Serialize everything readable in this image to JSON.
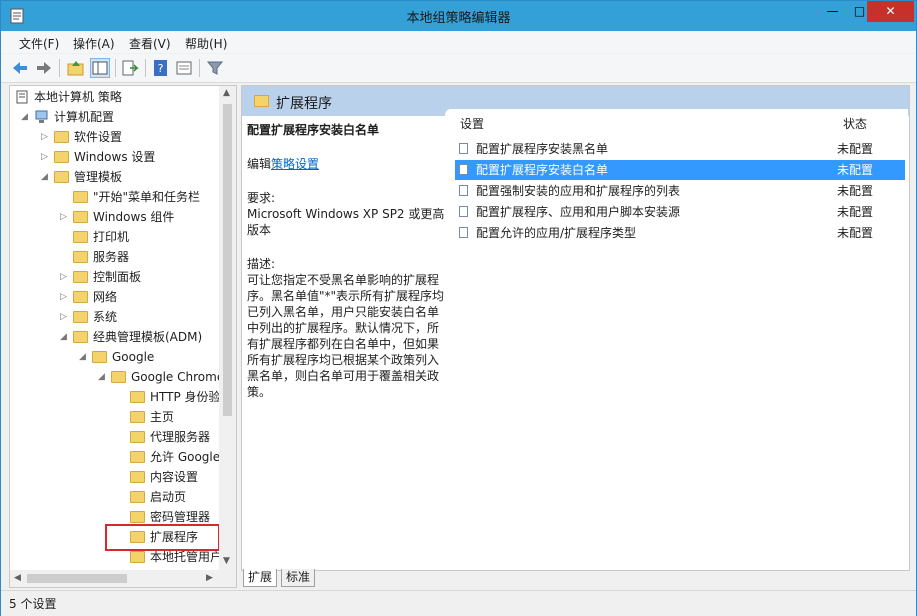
{
  "window": {
    "title": "本地组策略编辑器",
    "minimize": "—",
    "maximize": "□",
    "close": "✕"
  },
  "menu": [
    "文件(F)",
    "操作(A)",
    "查看(V)",
    "帮助(H)"
  ],
  "toolbar_icons": [
    "back-icon",
    "forward-icon",
    "up-folder-icon",
    "show-hide-tree-icon",
    "export-list-icon",
    "help-icon",
    "properties-icon",
    "filter-icon"
  ],
  "tree": {
    "root": "本地计算机 策略",
    "items": [
      {
        "label": "计算机配置"
      },
      {
        "label": "软件设置"
      },
      {
        "label": "Windows 设置"
      },
      {
        "label": "管理模板"
      },
      {
        "label": "\"开始\"菜单和任务栏"
      },
      {
        "label": "Windows 组件"
      },
      {
        "label": "打印机"
      },
      {
        "label": "服务器"
      },
      {
        "label": "控制面板"
      },
      {
        "label": "网络"
      },
      {
        "label": "系统"
      },
      {
        "label": "经典管理模板(ADM)"
      },
      {
        "label": "Google"
      },
      {
        "label": "Google Chrome"
      },
      {
        "label": "HTTP 身份验"
      },
      {
        "label": "主页"
      },
      {
        "label": "代理服务器"
      },
      {
        "label": "允许 Google"
      },
      {
        "label": "内容设置"
      },
      {
        "label": "启动页"
      },
      {
        "label": "密码管理器"
      },
      {
        "label": "扩展程序"
      },
      {
        "label": "本地托管用户"
      }
    ]
  },
  "right": {
    "header": "扩展程序",
    "desc_title": "配置扩展程序安装白名单",
    "edit_prefix": "编辑",
    "edit_link": "策略设置",
    "req_label": "要求:",
    "req_line1": "Microsoft Windows XP SP2 或更高",
    "req_line2": "版本",
    "desc_label": "描述:",
    "desc_lines": [
      "可让您指定不受黑名单影响的扩展程",
      "序。黑名单值\"*\"表示所有扩展程序均",
      "已列入黑名单，用户只能安装白名单",
      "中列出的扩展程序。默认情况下，所",
      "有扩展程序都列在白名单中，但如果",
      "所有扩展程序均已根据某个政策列入",
      "黑名单，则白名单可用于覆盖相关政",
      "策。"
    ],
    "col_setting": "设置",
    "col_state": "状态",
    "rows": [
      {
        "name": "配置扩展程序安装黑名单",
        "state": "未配置"
      },
      {
        "name": "配置扩展程序安装白名单",
        "state": "未配置"
      },
      {
        "name": "配置强制安装的应用和扩展程序的列表",
        "state": "未配置"
      },
      {
        "name": "配置扩展程序、应用和用户脚本安装源",
        "state": "未配置"
      },
      {
        "name": "配置允许的应用/扩展程序类型",
        "state": "未配置"
      }
    ],
    "tabs": [
      "扩展",
      "标准"
    ]
  },
  "status": "5 个设置",
  "colors": {
    "title_bar": "#33a1d8",
    "close_button": "#c7302b",
    "selection": "#3399ff",
    "pane_header": "#b9d1ea",
    "highlight_box": "#d9272e"
  }
}
